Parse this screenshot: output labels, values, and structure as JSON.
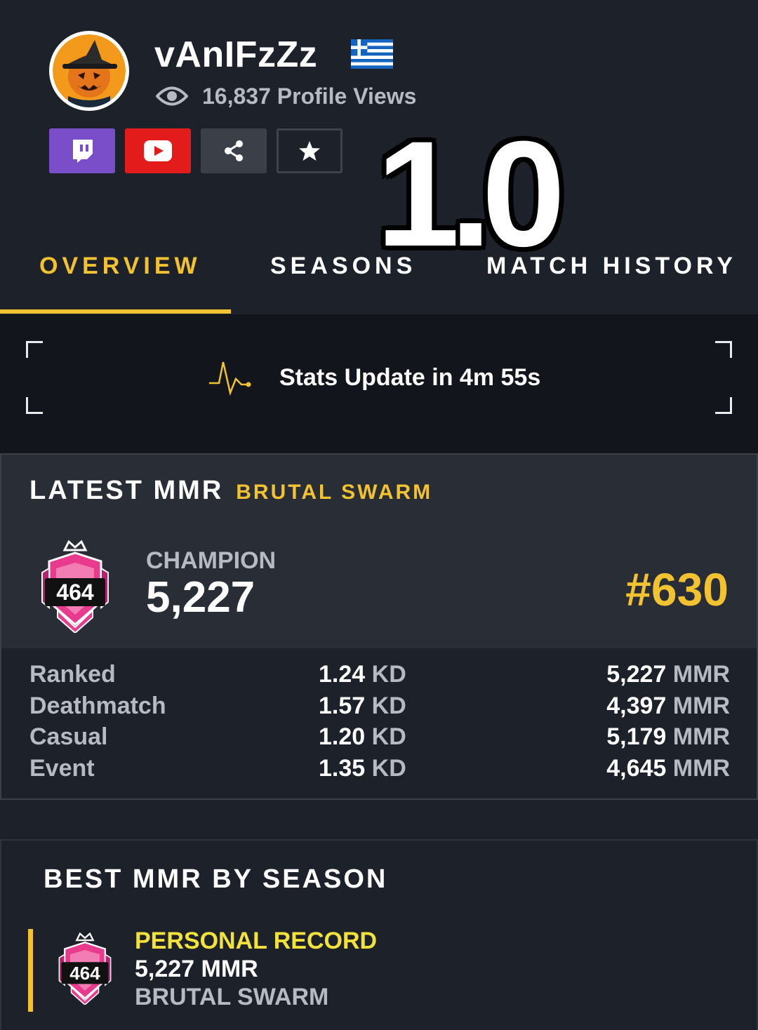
{
  "profile": {
    "username": "vAnIFzZz",
    "country_flag": "greece-flag",
    "views_count": "16,837",
    "views_label": "Profile Views"
  },
  "social": [
    {
      "name": "twitch",
      "icon": "twitch-icon",
      "color": "#7b4ec9"
    },
    {
      "name": "youtube",
      "icon": "youtube-icon",
      "color": "#e31b1b"
    },
    {
      "name": "share",
      "icon": "share-icon",
      "color": "#3a3f48"
    },
    {
      "name": "favorite",
      "icon": "star-icon",
      "color": "#1d2129"
    }
  ],
  "overlay_text": "1.0",
  "tabs": [
    {
      "label": "OVERVIEW",
      "active": true
    },
    {
      "label": "SEASONS",
      "active": false
    },
    {
      "label": "MATCH HISTORY",
      "active": false
    }
  ],
  "update": {
    "icon": "pulse-icon",
    "text": "Stats Update in 4m 55s"
  },
  "latest_mmr": {
    "title": "LATEST MMR",
    "season": "BRUTAL SWARM",
    "rank_badge_number": "464",
    "rank_name": "CHAMPION",
    "mmr": "5,227",
    "position": "#630"
  },
  "modes": [
    {
      "name": "Ranked",
      "kd": "1.24",
      "kd_unit": "KD",
      "mmr": "5,227",
      "mmr_unit": "MMR"
    },
    {
      "name": "Deathmatch",
      "kd": "1.57",
      "kd_unit": "KD",
      "mmr": "4,397",
      "mmr_unit": "MMR"
    },
    {
      "name": "Casual",
      "kd": "1.20",
      "kd_unit": "KD",
      "mmr": "5,179",
      "mmr_unit": "MMR"
    },
    {
      "name": "Event",
      "kd": "1.35",
      "kd_unit": "KD",
      "mmr": "4,645",
      "mmr_unit": "MMR"
    }
  ],
  "best_mmr": {
    "title": "BEST MMR BY SEASON",
    "label": "PERSONAL RECORD",
    "mmr": "5,227 MMR",
    "season": "BRUTAL SWARM",
    "rank_badge_number": "464"
  },
  "colors": {
    "background": "#1d2129",
    "accent": "#f2c230",
    "card": "#282d36",
    "update_bar": "#12151c"
  }
}
